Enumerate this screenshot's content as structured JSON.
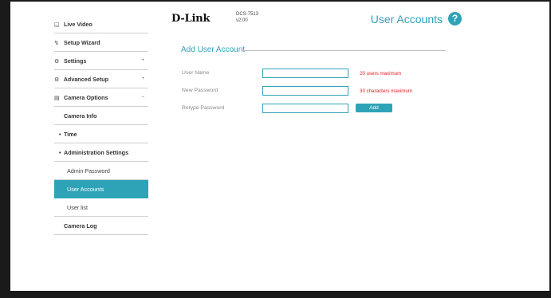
{
  "sidebar": {
    "items": [
      {
        "label": "Live Video",
        "icon": "camera-icon"
      },
      {
        "label": "Setup Wizard",
        "icon": "wand-icon"
      },
      {
        "label": "Settings",
        "icon": "gear-icon"
      },
      {
        "label": "Advanced Setup",
        "icon": "advanced-gear-icon"
      },
      {
        "label": "Camera Options",
        "icon": "document-icon"
      },
      {
        "label": "Camera Info"
      },
      {
        "label": "Time"
      },
      {
        "label": "Administration Settings"
      },
      {
        "label": "Admin Password"
      },
      {
        "label": "User Accounts"
      },
      {
        "label": "User list"
      },
      {
        "label": "Camera Log"
      }
    ]
  },
  "header": {
    "brand": "D-Link",
    "model": "DCS-7513",
    "version": "v2.00",
    "title": "User Accounts",
    "help": "?"
  },
  "form": {
    "section_title": "Add User Account",
    "username_label": "User Name",
    "username_value": "",
    "username_hint": "20 users maximum",
    "password_label": "New Password",
    "password_value": "",
    "password_hint": "30 characters maximum",
    "retype_label": "Retype Password",
    "retype_value": "",
    "add_label": "Add"
  },
  "colors": {
    "accent": "#2ea3b7",
    "hint": "#e02020",
    "frame": "#1a1a1a"
  }
}
